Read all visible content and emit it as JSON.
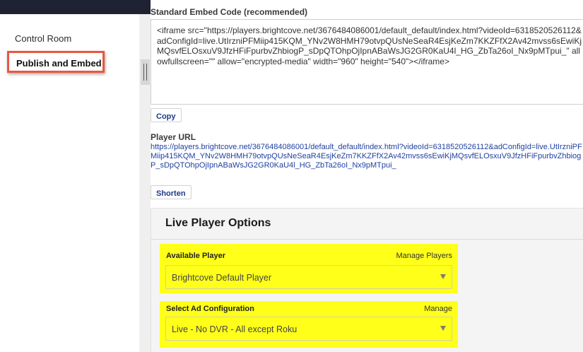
{
  "sidebar": {
    "items": [
      {
        "label": "Control Room"
      },
      {
        "label": "Publish and Embed"
      }
    ]
  },
  "embed": {
    "title": "Standard Embed Code (recommended)",
    "code": "<iframe src=\"https://players.brightcove.net/3676484086001/default_default/index.html?videoId=6318520526112&adConfigId=live.UtIrzniPFMiip415KQM_YNv2W8HMH79otvpQUsNeSeaR4EsjKeZm7KKZFfX2Av42mvss6sEwiKjMQsvfELOsxuV9JfzHFiFpurbvZhbiogP_sDpQTOhpOjIpnABaWsJG2GR0KaU4l_HG_ZbTa26oI_Nx9pMTpui_\" allowfullscreen=\"\" allow=\"encrypted-media\" width=\"960\" height=\"540\"></iframe>",
    "copy_label": "Copy"
  },
  "player_url": {
    "label": "Player URL",
    "url": "https://players.brightcove.net/3676484086001/default_default/index.html?videoId=6318520526112&adConfigId=live.UtIrzniPFMiip415KQM_YNv2W8HMH79otvpQUsNeSeaR4EsjKeZm7KKZFfX2Av42mvss6sEwiKjMQsvfELOsxuV9JfzHFiFpurbvZhbiogP_sDpQTOhpOjIpnABaWsJG2GR0KaU4l_HG_ZbTa26oI_Nx9pMTpui_",
    "shorten_label": "Shorten"
  },
  "live_options": {
    "title": "Live Player Options",
    "available_player": {
      "label": "Available Player",
      "link": "Manage Players",
      "value": "Brightcove Default Player"
    },
    "ad_config": {
      "label": "Select Ad Configuration",
      "link": "Manage",
      "value": "Live - No DVR - All except Roku"
    }
  },
  "colors": {
    "highlight": "#ffff1a",
    "focus_outline": "#e9573f",
    "link": "#1f3fa0",
    "topbar": "#1f2233"
  },
  "icons": {
    "select_caret": "chevron-down-icon",
    "splitter": "drag-handle-icon"
  }
}
